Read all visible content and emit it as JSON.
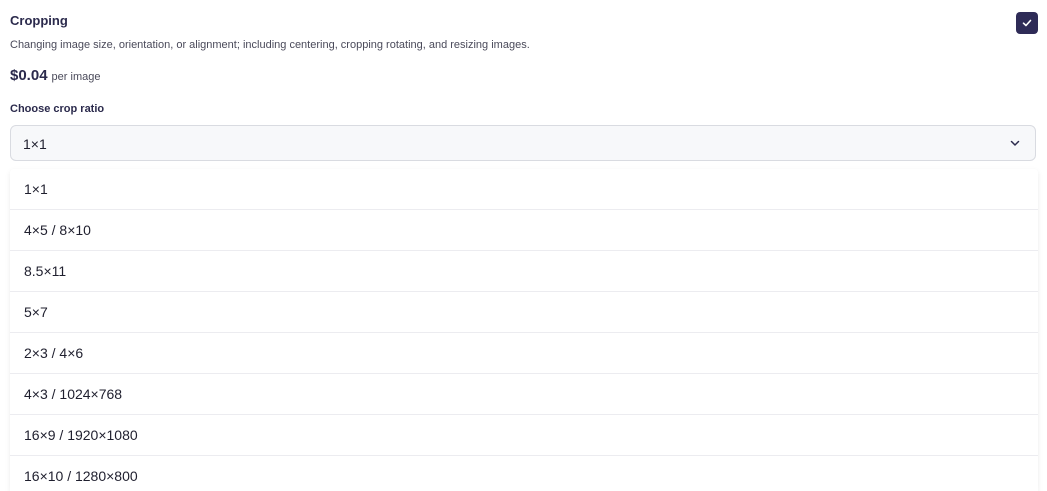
{
  "service": {
    "title": "Cropping",
    "description": "Changing image size, orientation, or alignment; including centering, cropping rotating, and resizing images.",
    "price": "$0.04",
    "price_unit": "per image",
    "checked": true
  },
  "crop": {
    "label": "Choose crop ratio",
    "selected": "1×1",
    "options": [
      "1×1",
      "4×5 / 8×10",
      "8.5×11",
      "5×7",
      "2×3 / 4×6",
      "4×3 / 1024×768",
      "16×9 / 1920×1080",
      "16×10 / 1280×800"
    ]
  },
  "colors": {
    "accent": "#2e2b57",
    "title": "#2b2a4c"
  }
}
